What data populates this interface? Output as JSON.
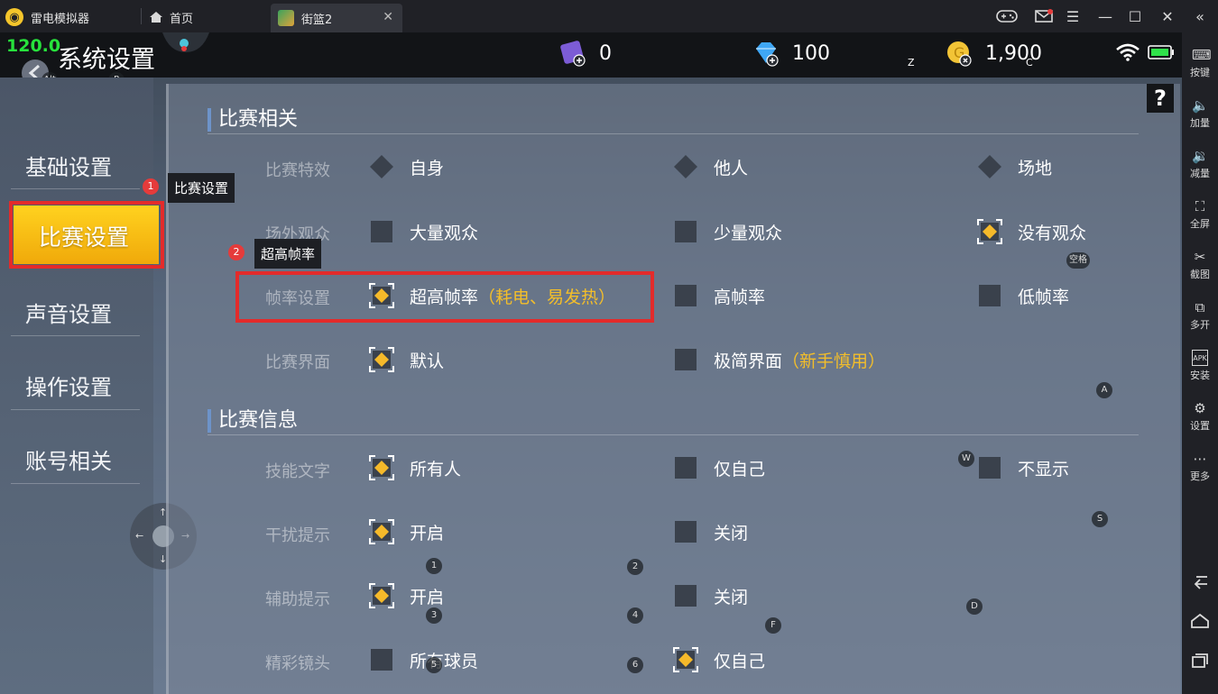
{
  "titlebar": {
    "app_name": "雷电模拟器",
    "home_tab": "首页",
    "game_tab": "街篮2",
    "icons": [
      "gamepad-icon",
      "mail-icon",
      "menu-icon",
      "minimize-icon",
      "maximize-icon",
      "close-icon",
      "collapse-icon"
    ]
  },
  "rightbar": {
    "items": [
      {
        "label": "按键",
        "icon": "keyboard-icon"
      },
      {
        "label": "加量",
        "icon": "volume-up-icon"
      },
      {
        "label": "减量",
        "icon": "volume-down-icon"
      },
      {
        "label": "全屏",
        "icon": "fullscreen-icon"
      },
      {
        "label": "截图",
        "icon": "scissors-icon"
      },
      {
        "label": "多开",
        "icon": "multi-instance-icon"
      },
      {
        "label": "安装",
        "icon": "apk-icon"
      },
      {
        "label": "设置",
        "icon": "gear-icon"
      },
      {
        "label": "更多",
        "icon": "more-icon"
      }
    ]
  },
  "game": {
    "fps": "120.0",
    "title": "系统设置",
    "key_alt": "Alt",
    "key_p": "P",
    "currencies": [
      {
        "icon": "ticket-icon",
        "value": "0"
      },
      {
        "icon": "diamond-icon",
        "value": "100",
        "key": "Z"
      },
      {
        "icon": "gold-coin-icon",
        "value": "1,900",
        "key": "C",
        "icon_key": "X"
      }
    ],
    "menu": [
      "基础设置",
      "比赛设置",
      "声音设置",
      "操作设置",
      "账号相关"
    ],
    "help": "?",
    "sections": {
      "match": {
        "title": "比赛相关",
        "rows": [
          {
            "label": "比赛特效",
            "options": [
              "自身",
              "他人",
              "场地"
            ]
          },
          {
            "label": "场外观众",
            "options": [
              "大量观众",
              "少量观众",
              "没有观众"
            ]
          },
          {
            "label": "帧率设置",
            "options": [
              "超高帧率",
              "高帧率",
              "低帧率"
            ],
            "note": "（耗电、易发热）"
          },
          {
            "label": "比赛界面",
            "options": [
              "默认",
              "极简界面"
            ],
            "note": "（新手慎用）"
          }
        ]
      },
      "info": {
        "title": "比赛信息",
        "rows": [
          {
            "label": "技能文字",
            "options": [
              "所有人",
              "仅自己",
              "不显示"
            ]
          },
          {
            "label": "干扰提示",
            "options": [
              "开启",
              "关闭"
            ]
          },
          {
            "label": "辅助提示",
            "options": [
              "开启",
              "关闭"
            ]
          },
          {
            "label": "精彩镜头",
            "options": [
              "所有球员",
              "仅自己"
            ]
          }
        ]
      }
    },
    "keys": {
      "space": "空格",
      "a": "A",
      "w": "W",
      "s": "S",
      "d": "D",
      "f": "F",
      "n1": "1",
      "n2": "2",
      "n3": "3",
      "n4": "4",
      "n5": "5",
      "n6": "6"
    }
  },
  "annotations": [
    {
      "badge": "1",
      "text": "比赛设置"
    },
    {
      "badge": "2",
      "text": "超高帧率"
    }
  ],
  "colors": {
    "accent": "#f3be2a",
    "highlight": "#e32b2b",
    "fps": "#27e23c"
  }
}
